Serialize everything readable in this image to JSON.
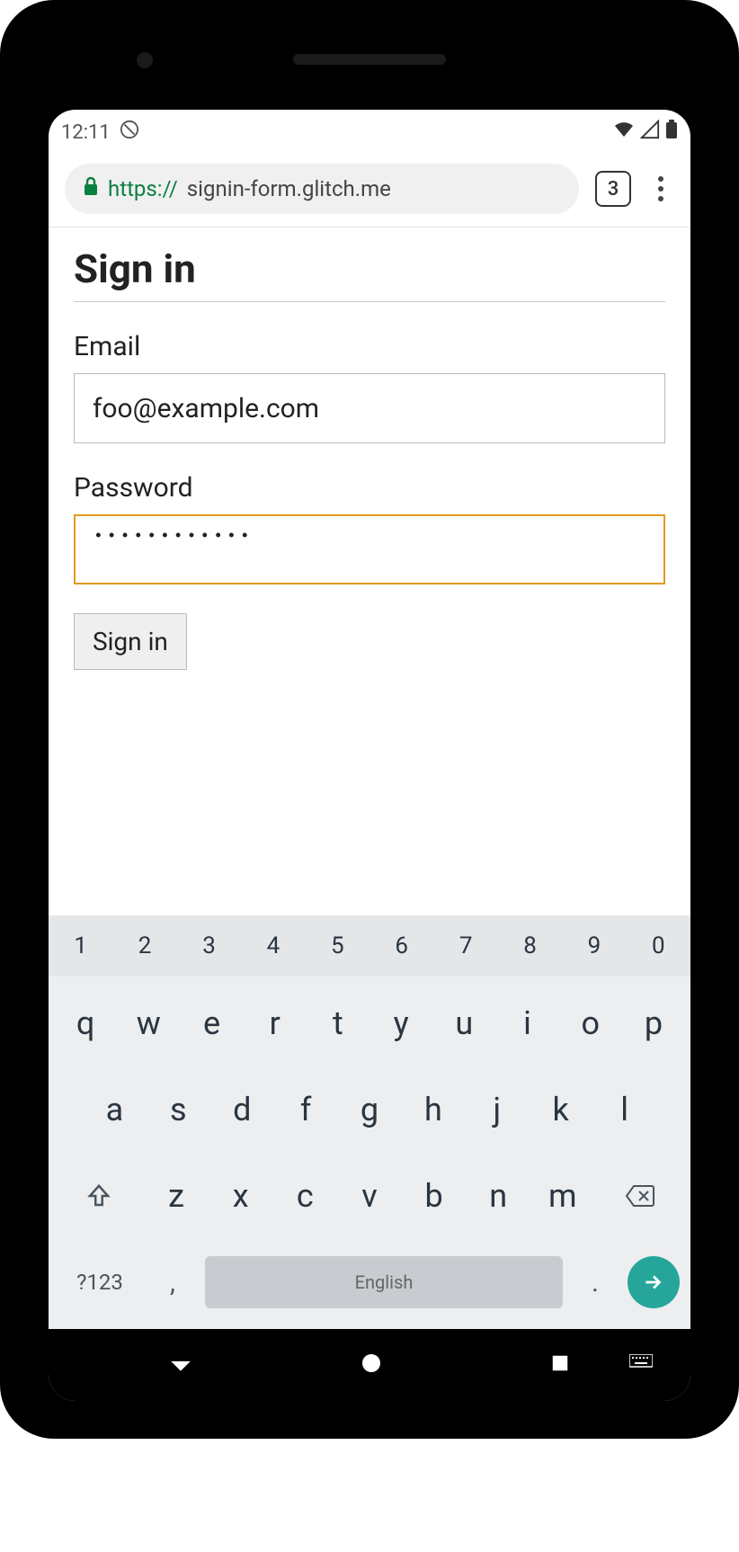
{
  "status_bar": {
    "time": "12:11"
  },
  "browser": {
    "scheme": "https://",
    "host": "signin-form.glitch.me",
    "tab_count": "3"
  },
  "page": {
    "title": "Sign in",
    "form": {
      "email_label": "Email",
      "email_value": "foo@example.com",
      "password_label": "Password",
      "password_value": "••••••••••••",
      "submit_label": "Sign in"
    }
  },
  "keyboard": {
    "numbers": [
      "1",
      "2",
      "3",
      "4",
      "5",
      "6",
      "7",
      "8",
      "9",
      "0"
    ],
    "row1": [
      "q",
      "w",
      "e",
      "r",
      "t",
      "y",
      "u",
      "i",
      "o",
      "p"
    ],
    "row2": [
      "a",
      "s",
      "d",
      "f",
      "g",
      "h",
      "j",
      "k",
      "l"
    ],
    "row3": [
      "z",
      "x",
      "c",
      "v",
      "b",
      "n",
      "m"
    ],
    "symbols_label": "?123",
    "comma": ",",
    "space_label": "English",
    "period": "."
  }
}
